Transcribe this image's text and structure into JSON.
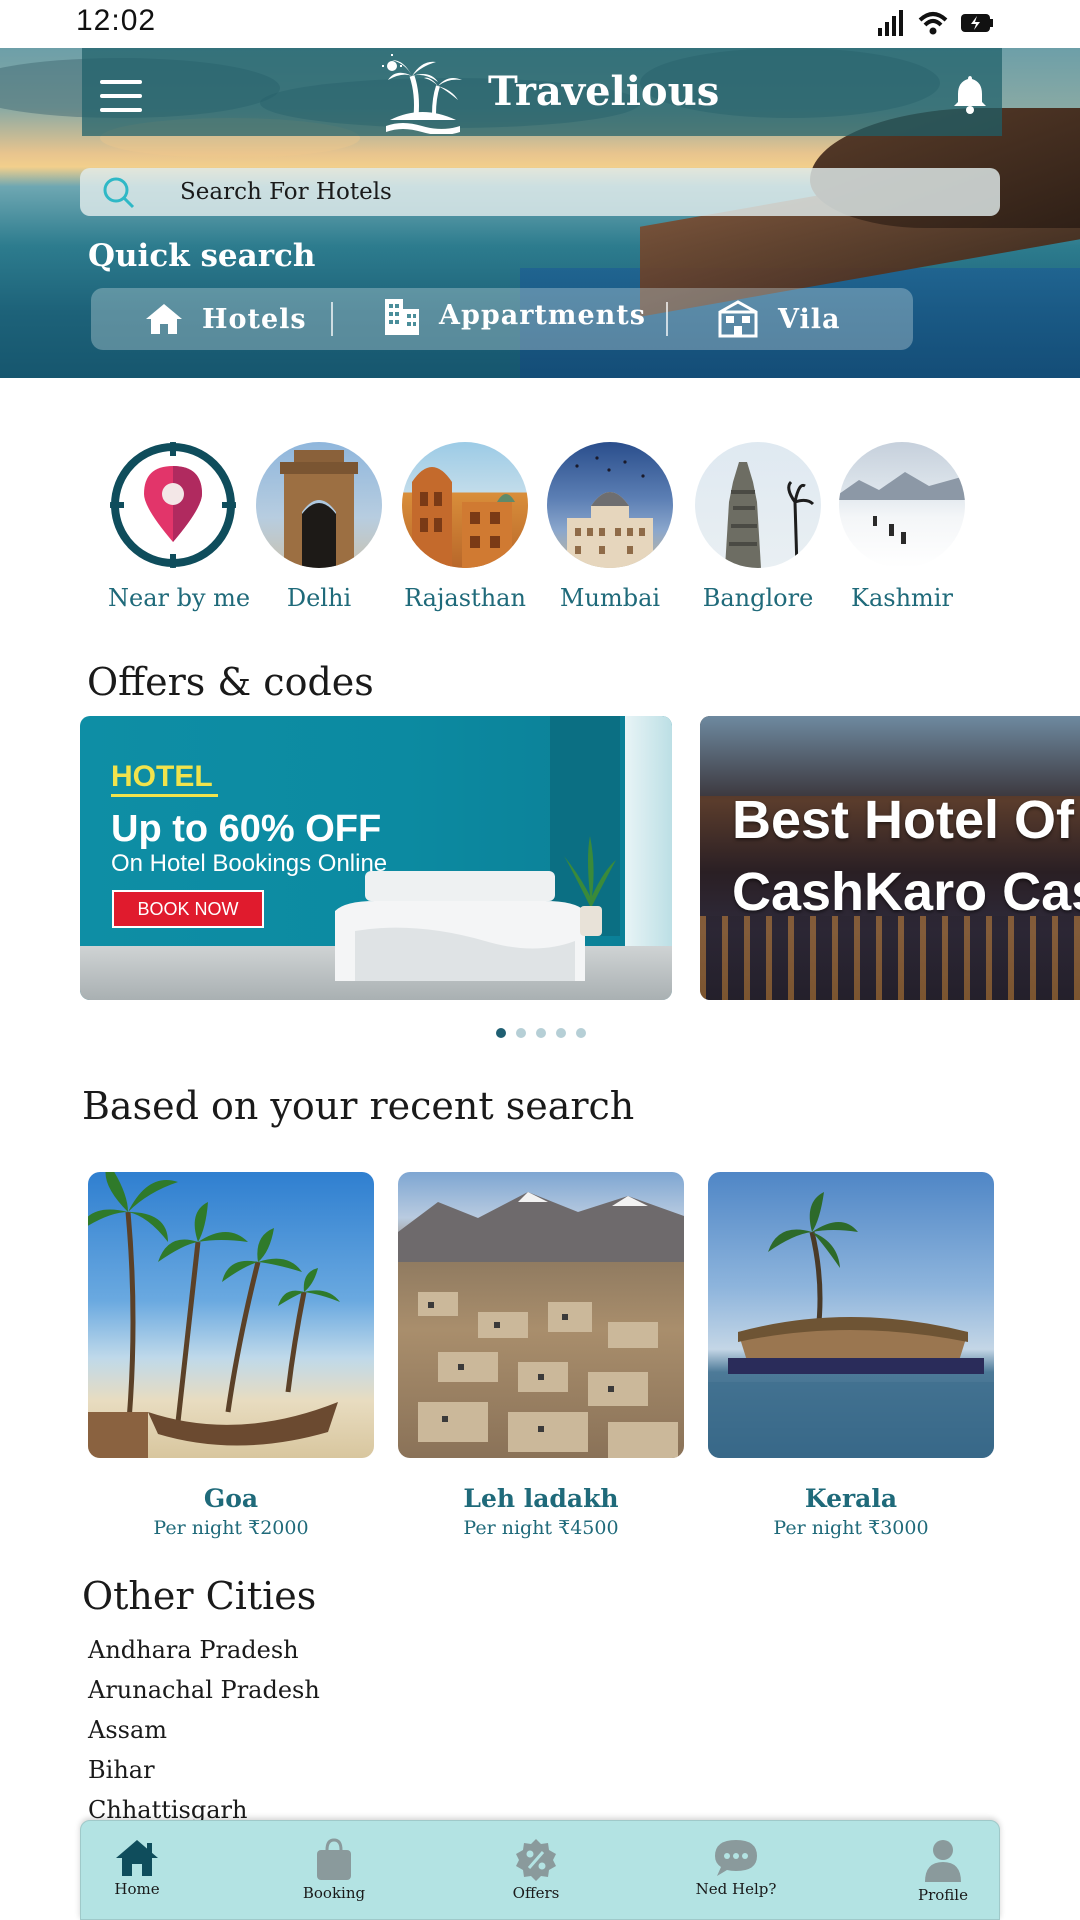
{
  "status": {
    "time": "12:02"
  },
  "header": {
    "title": "Travelious"
  },
  "search": {
    "placeholder": "Search For Hotels"
  },
  "quick_search": {
    "title": "Quick search",
    "buttons": [
      {
        "label": "Hotels",
        "icon": "house-icon"
      },
      {
        "label": "Appartments",
        "icon": "building-icon"
      },
      {
        "label": "Vila",
        "icon": "villa-icon"
      }
    ]
  },
  "destinations": [
    {
      "name": "Near by me",
      "icon": "location-pin-icon"
    },
    {
      "name": "Delhi"
    },
    {
      "name": "Rajasthan"
    },
    {
      "name": "Mumbai"
    },
    {
      "name": "Banglore"
    },
    {
      "name": "Kashmir"
    }
  ],
  "offers": {
    "title": "Offers & codes",
    "cards": [
      {
        "tag": "HOTEL",
        "headline": "Up to 60% OFF",
        "sub": "On Hotel Bookings Online",
        "cta": "BOOK NOW"
      },
      {
        "line1": "Best Hotel Of",
        "line2": "CashKaro Cas"
      }
    ],
    "dots": 5,
    "active_dot": 0
  },
  "recent": {
    "title": "Based on your recent search",
    "items": [
      {
        "city": "Goa",
        "price": "Per night ₹2000"
      },
      {
        "city": "Leh ladakh",
        "price": "Per night ₹4500"
      },
      {
        "city": "Kerala",
        "price": "Per night ₹3000"
      }
    ]
  },
  "other_cities": {
    "title": "Other Cities",
    "items": [
      "Andhara Pradesh",
      "Arunachal Pradesh",
      "Assam",
      "Bihar",
      "Chhattisgarh"
    ]
  },
  "bottom_nav": [
    {
      "label": "Home",
      "icon": "home-icon",
      "active": true
    },
    {
      "label": "Booking",
      "icon": "shopping-bag-icon"
    },
    {
      "label": "Offers",
      "icon": "percent-badge-icon"
    },
    {
      "label": "Ned Help?",
      "icon": "chat-bubble-icon"
    },
    {
      "label": "Profile",
      "icon": "user-icon"
    }
  ],
  "colors": {
    "accent": "#1f6a7a",
    "nav_bg": "#b3e3e3",
    "cta": "#e01b2d",
    "tag": "#f2e34c"
  }
}
